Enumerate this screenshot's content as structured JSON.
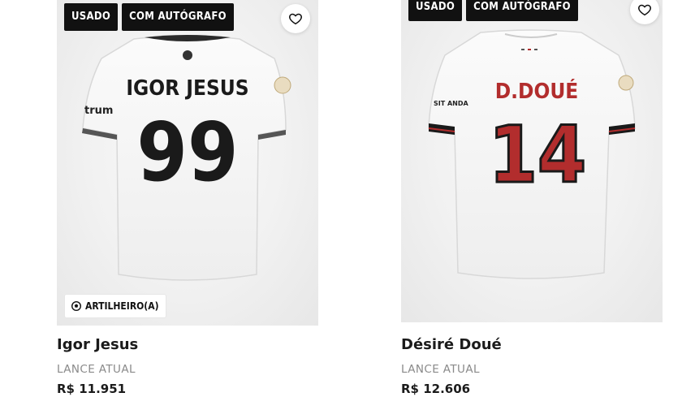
{
  "products": [
    {
      "tags": [
        "USADO",
        "COM AUTÓGRAFO"
      ],
      "shirt_name": "IGOR JESUS",
      "shirt_number": "99",
      "sleeve_text": "trum",
      "badge": "ARTILHEIRO(A)",
      "title": "Igor Jesus",
      "bid_label": "LANCE ATUAL",
      "price": "R$ 11.951"
    },
    {
      "tags": [
        "USADO",
        "COM AUTÓGRAFO"
      ],
      "shirt_name": "D.DOUÉ",
      "shirt_number": "14",
      "sleeve_text": "SIT ANDA",
      "title": "Désiré Doué",
      "bid_label": "LANCE ATUAL",
      "price": "R$ 12.606"
    }
  ],
  "colors": {
    "tag_bg": "#111111",
    "shirt_white": "#f7f7f7",
    "doue_number_red": "#b22d2d",
    "doue_trim": "#1a1a1a"
  },
  "icons": [
    "heart-icon",
    "football-icon"
  ]
}
